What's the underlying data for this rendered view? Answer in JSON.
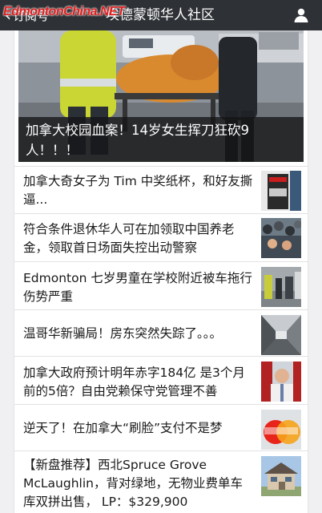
{
  "nav": {
    "back_label": "订阅号",
    "title": "埃德蒙顿华人社区",
    "watermark": "EdmontonChina.NET"
  },
  "hero": {
    "title": "加拿大校园血案！14岁女生挥刀狂砍9人！！！"
  },
  "articles": [
    {
      "title": "加拿大奇女子为 Tim 中奖纸杯，和好友撕逼...",
      "thumb": "tim-cup-thumbnail"
    },
    {
      "title": "符合条件退休华人可在加领取中国养老金，领取首日场面失控出动警察",
      "thumb": "crowd-thumbnail"
    },
    {
      "title": "Edmonton 七岁男童在学校附近被车拖行伤势严重",
      "thumb": "street-scene-thumbnail"
    },
    {
      "title": "温哥华新骗局！房东突然失踪了。。。",
      "thumb": "hallway-thumbnail"
    },
    {
      "title": "加拿大政府预计明年赤字184亿 是3个月前的5倍？自由党赖保守党管理不善",
      "thumb": "politician-thumbnail"
    },
    {
      "title": "逆天了！在加拿大“刷脸”支付不是梦",
      "thumb": "mastercard-thumbnail"
    },
    {
      "title": "【新盘推荐】西北Spruce Grove McLaughlin，背对绿地，无物业费单车库双拼出售， LP：$329,900",
      "thumb": "house-thumbnail"
    }
  ]
}
